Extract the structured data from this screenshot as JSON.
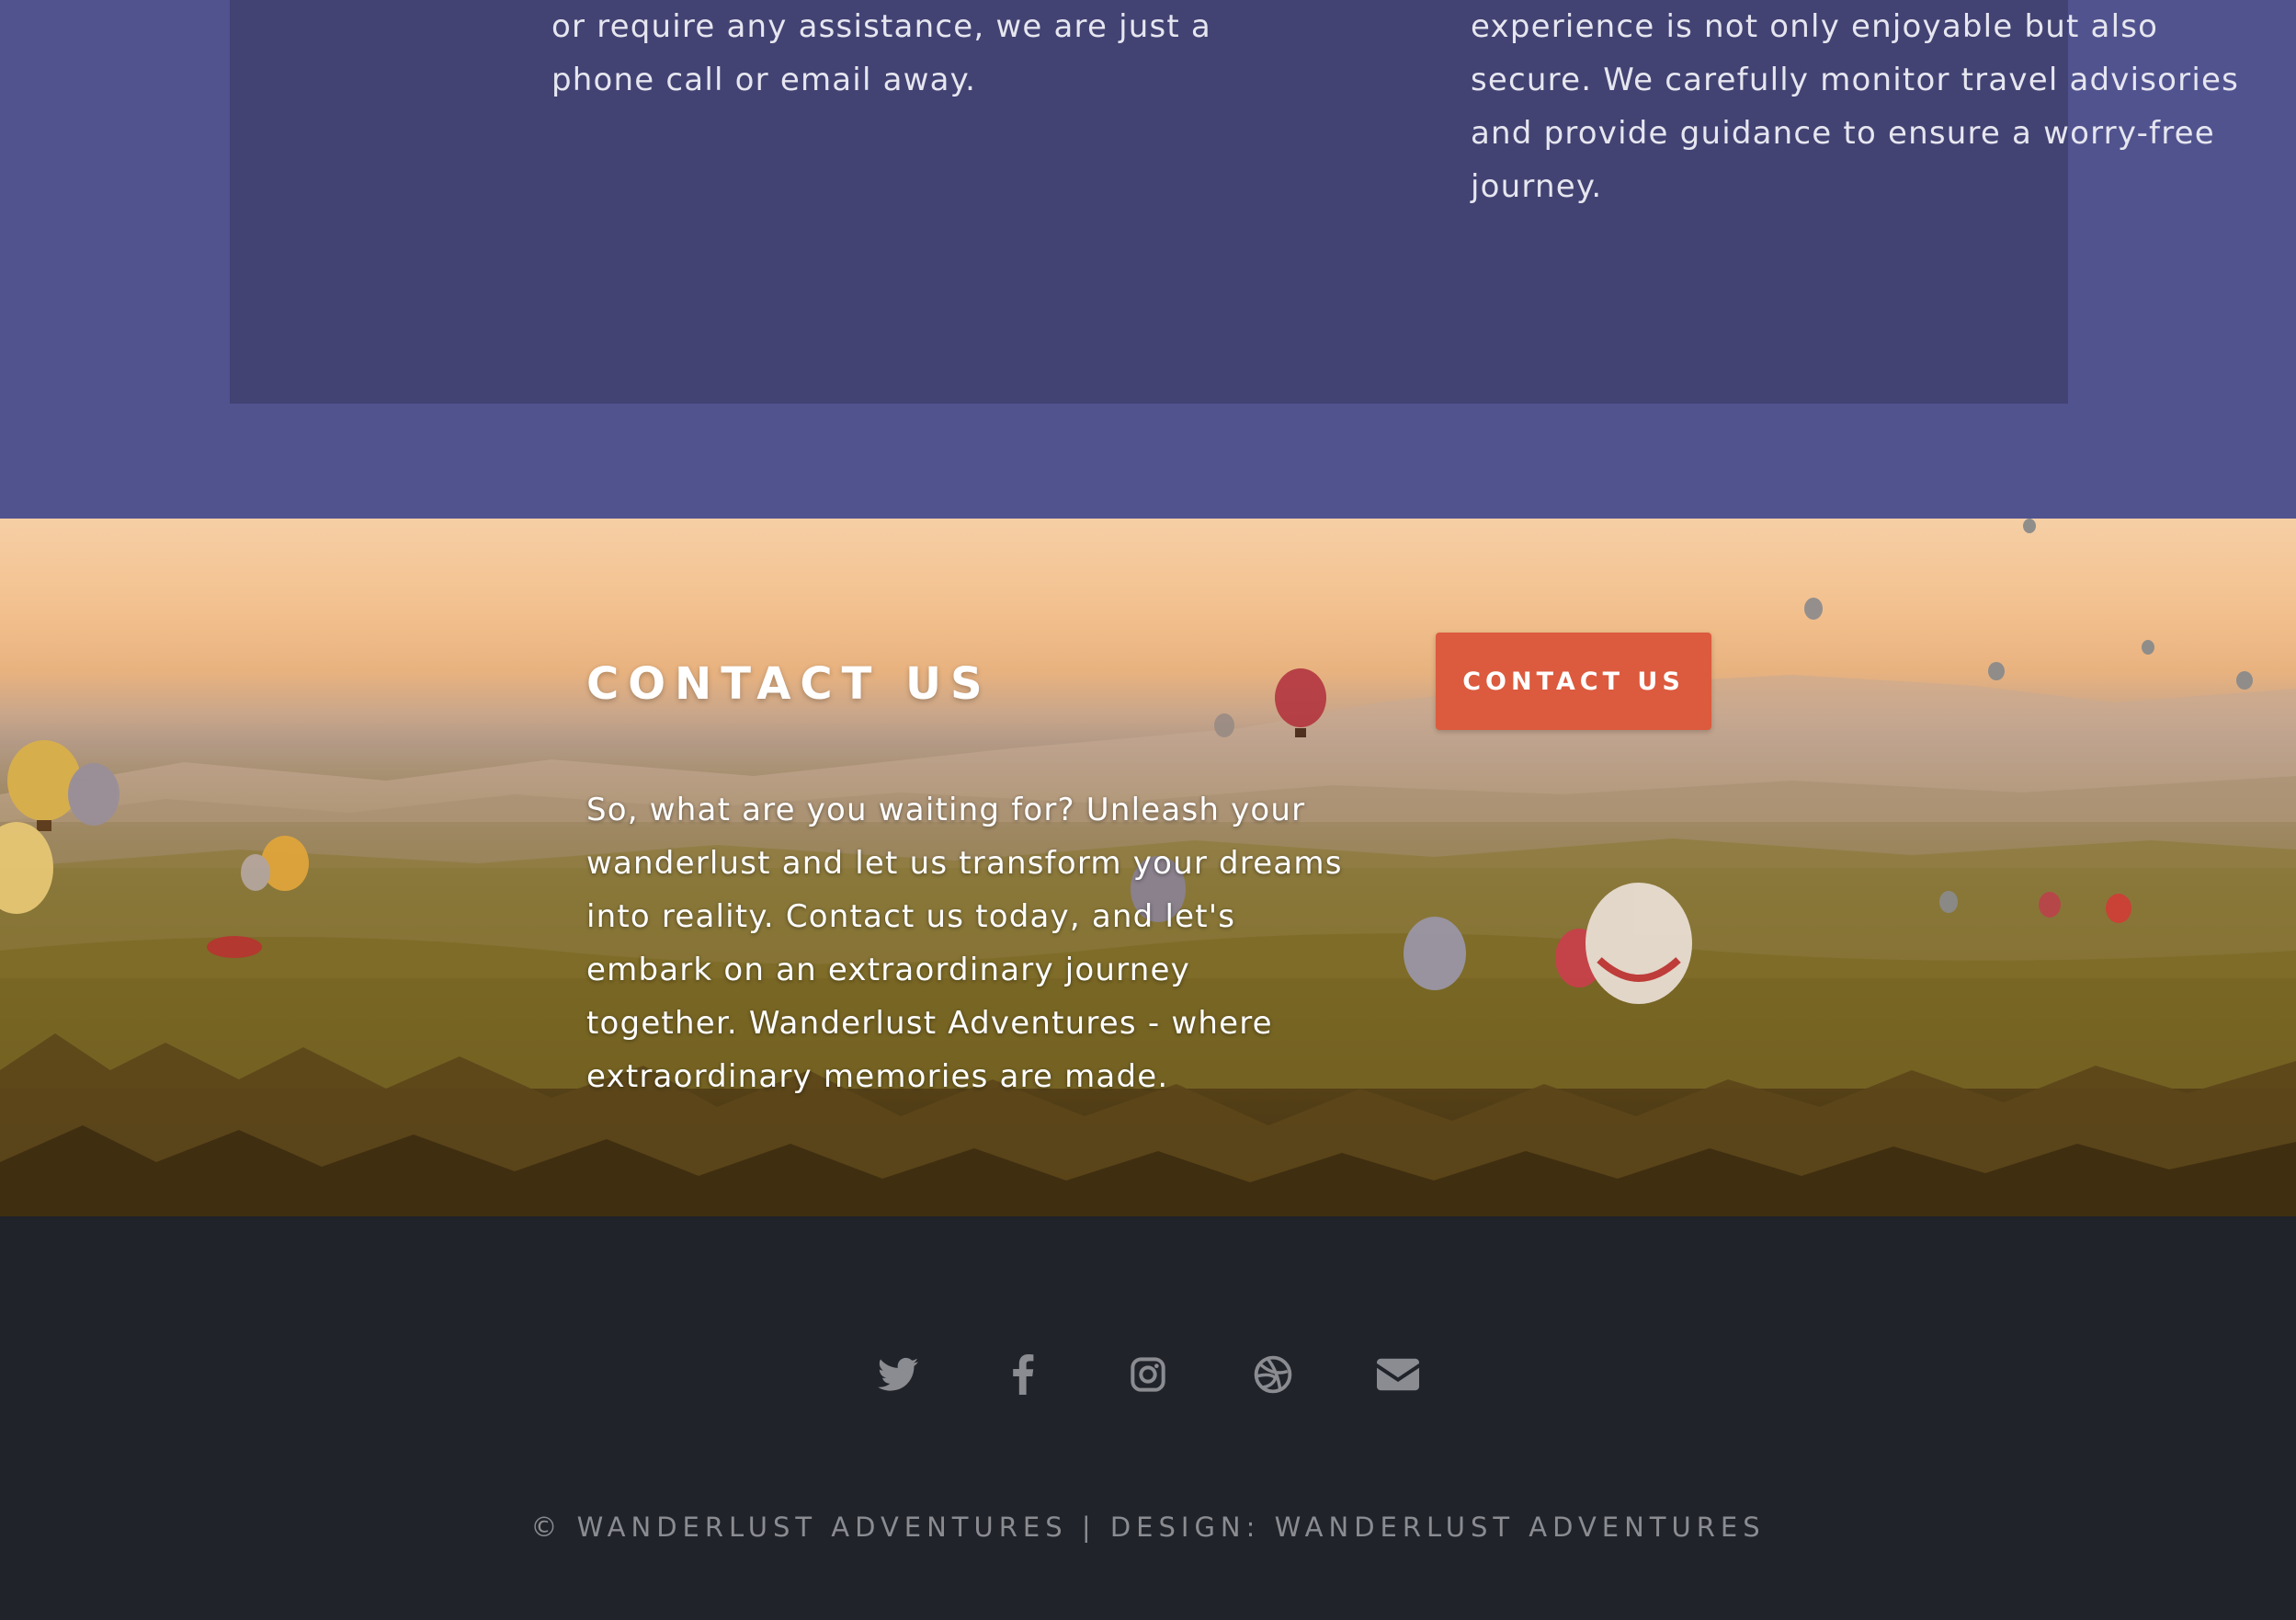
{
  "features": {
    "left_text": "or require any assistance, we are just a phone call or email away.",
    "right_text": "experience is not only enjoyable but also secure. We carefully monitor travel advisories and provide guidance to ensure a worry-free journey."
  },
  "contact": {
    "title": "CONTACT US",
    "body": "So, what are you waiting for? Unleash your wanderlust and let us transform your dreams into reality. Contact us today, and let's embark on an extraordinary journey together. Wanderlust Adventures - where extraordinary memories are made.",
    "button_label": "CONTACT US",
    "button_color": "#dc5a3e"
  },
  "footer": {
    "social": [
      {
        "icon": "twitter-icon"
      },
      {
        "icon": "facebook-icon"
      },
      {
        "icon": "instagram-icon"
      },
      {
        "icon": "dribbble-icon"
      },
      {
        "icon": "envelope-icon"
      }
    ],
    "copyright": "© WANDERLUST ADVENTURES | DESIGN: WANDERLUST ADVENTURES"
  },
  "colors": {
    "section_bg": "#51538f",
    "panel_bg": "#424273",
    "footer_bg": "#202329",
    "footer_icon": "#8a8c92"
  }
}
